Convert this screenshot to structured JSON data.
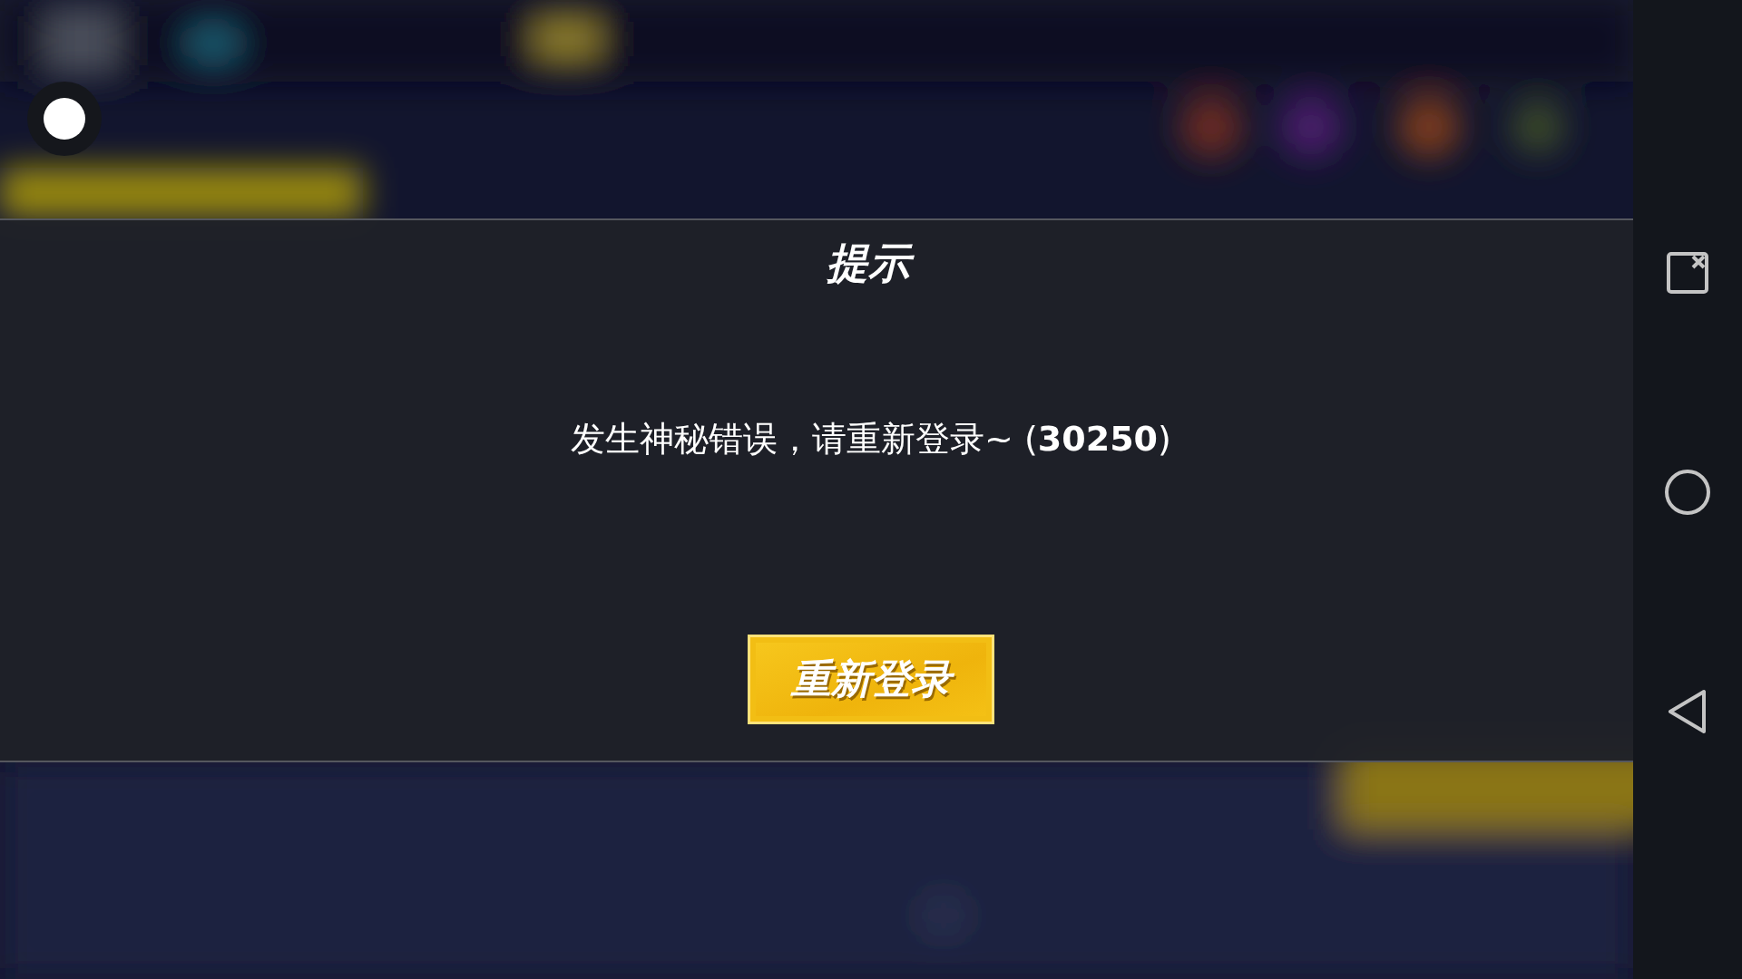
{
  "dialog": {
    "title": "提示",
    "message": "发生神秘错误，请重新登录~ (**30250**)",
    "button": "重新登录"
  }
}
